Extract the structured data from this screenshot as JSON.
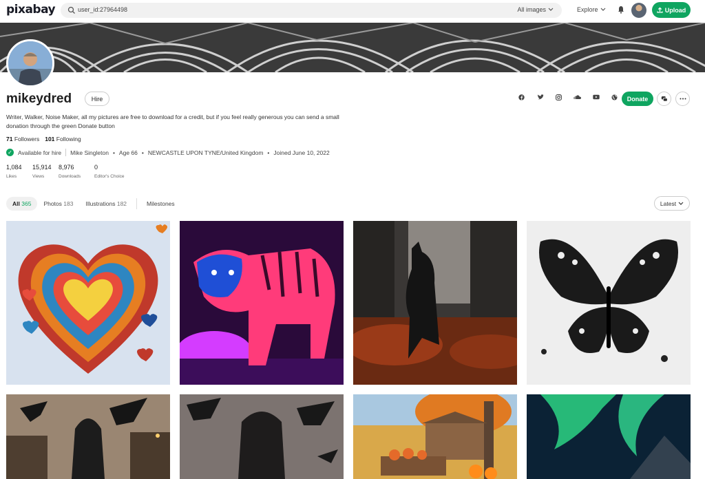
{
  "nav": {
    "logo": "pixabay",
    "search_value": "user_id:27964498",
    "filter_label": "All images",
    "explore_label": "Explore",
    "upload_label": "Upload"
  },
  "profile": {
    "username": "mikeydred",
    "hire_label": "Hire",
    "donate_label": "Donate",
    "bio": "Writer, Walker, Noise Maker, all my pictures are free to download for a credit, but if you feel really generous you can send a small donation through the green Donate button",
    "followers_count": "71",
    "followers_label": "Followers",
    "following_count": "101",
    "following_label": "Following",
    "available": "Available for hire",
    "name": "Mike Singleton",
    "age": "Age 66",
    "location": "NEWCASTLE UPON TYNE/United Kingdom",
    "joined": "Joined June 10, 2022",
    "stats": [
      {
        "value": "1,084",
        "label": "Likes"
      },
      {
        "value": "15,914",
        "label": "Views"
      },
      {
        "value": "8,976",
        "label": "Downloads"
      },
      {
        "value": "0",
        "label": "Editor's Choice"
      }
    ],
    "socials": [
      "facebook-icon",
      "twitter-icon",
      "instagram-icon",
      "soundcloud-icon",
      "youtube-icon",
      "website-icon"
    ]
  },
  "tabs": [
    {
      "label": "All",
      "count": "365"
    },
    {
      "label": "Photos",
      "count": "183"
    },
    {
      "label": "Illustrations",
      "count": "182"
    },
    {
      "label": "Milestones",
      "count": ""
    }
  ],
  "sort_label": "Latest",
  "colors": {
    "accent": "#0fa560"
  }
}
